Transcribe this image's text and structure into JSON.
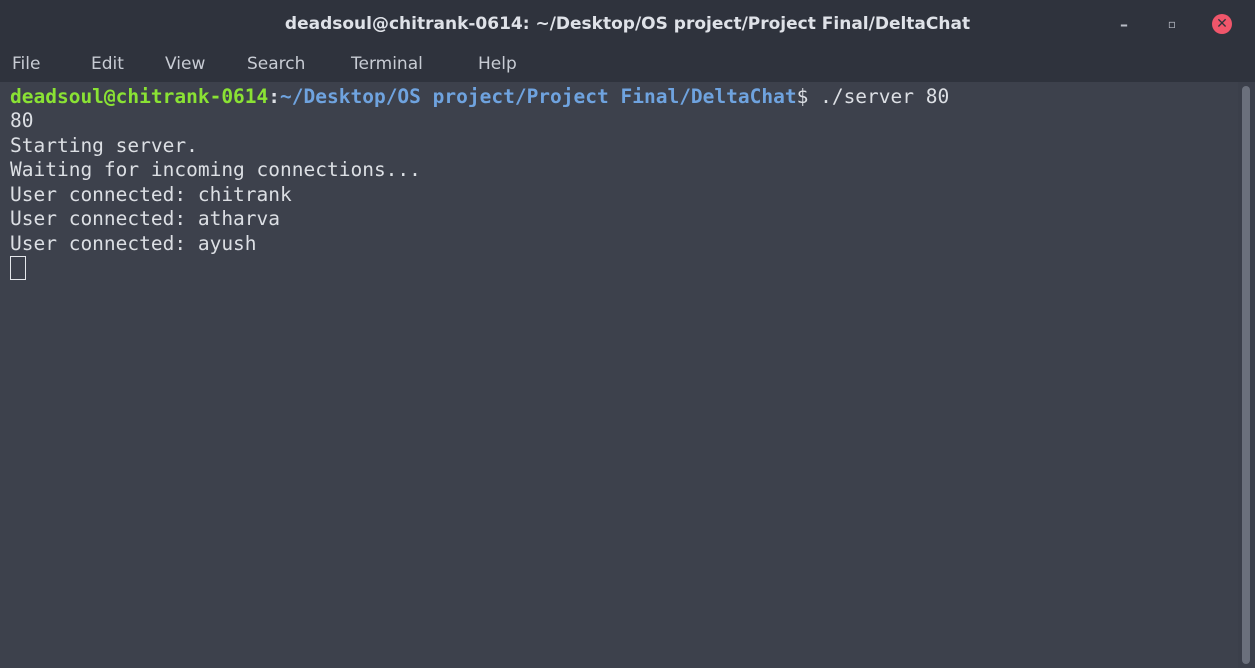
{
  "window": {
    "title": "deadsoul@chitrank-0614: ~/Desktop/OS project/Project Final/DeltaChat",
    "controls": {
      "minimize": "–",
      "maximize": "▫",
      "close": "✕"
    }
  },
  "menu": {
    "items": [
      "File",
      "Edit",
      "View",
      "Search",
      "Terminal",
      "Help"
    ]
  },
  "terminal": {
    "prompt_user": "deadsoul@chitrank-0614",
    "prompt_sep": ":",
    "prompt_path": "~/Desktop/OS project/Project Final/DeltaChat",
    "prompt_dollar": "$",
    "command": " ./server 80",
    "output": [
      "80",
      "Starting server.",
      "Waiting for incoming connections...",
      "User connected: chitrank",
      "User connected: atharva",
      "User connected: ayush"
    ]
  },
  "colors": {
    "prompt_user": "#8ae234",
    "prompt_path": "#6fa3df",
    "close_button": "#f0566b",
    "background": "#3d414c"
  }
}
